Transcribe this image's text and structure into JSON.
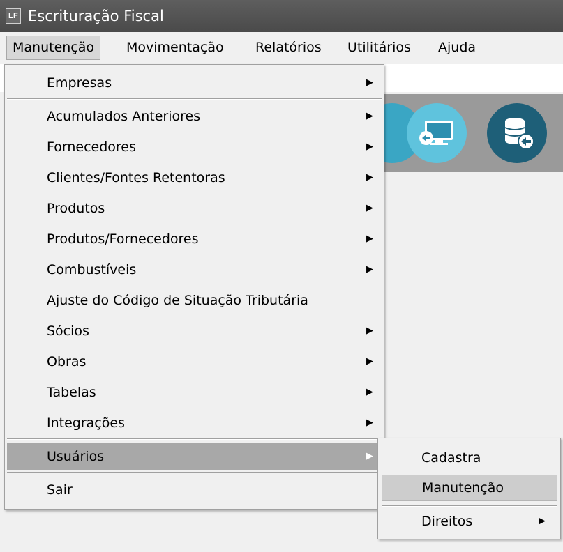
{
  "window": {
    "title": "Escrituração Fiscal",
    "app_icon": "LF"
  },
  "menubar": [
    "Manutenção",
    "Movimentação",
    "Relatórios",
    "Utilitários",
    "Ajuda"
  ],
  "dropdown": {
    "items": [
      {
        "label": "Empresas",
        "arrow": "▶"
      },
      {
        "label": "Acumulados Anteriores",
        "arrow": "▶"
      },
      {
        "label": "Fornecedores",
        "arrow": "▶"
      },
      {
        "label": "Clientes/Fontes Retentoras",
        "arrow": "▶"
      },
      {
        "label": "Produtos",
        "arrow": "▶"
      },
      {
        "label": "Produtos/Fornecedores",
        "arrow": "▶"
      },
      {
        "label": "Combustíveis",
        "arrow": "▶"
      },
      {
        "label": "Ajuste do Código de Situação Tributária"
      },
      {
        "label": "Sócios",
        "arrow": "▶"
      },
      {
        "label": "Obras",
        "arrow": "▶"
      },
      {
        "label": "Tabelas",
        "arrow": "▶"
      },
      {
        "label": "Integrações",
        "arrow": "▶"
      },
      {
        "label": "Usuários",
        "arrow": "▶"
      },
      {
        "label": "Sair"
      }
    ]
  },
  "submenu": {
    "items": [
      {
        "label": "Cadastra"
      },
      {
        "label": "Manutenção"
      },
      {
        "label": "Direitos",
        "arrow": "▶"
      }
    ]
  },
  "toolbar_icons": [
    "monitor-login-icon",
    "database-return-icon"
  ],
  "colors": {
    "titlebar": "#555555",
    "selected": "#a8a8a8",
    "icon_light": "#5fc3dd",
    "icon_dark": "#1e5f78"
  }
}
